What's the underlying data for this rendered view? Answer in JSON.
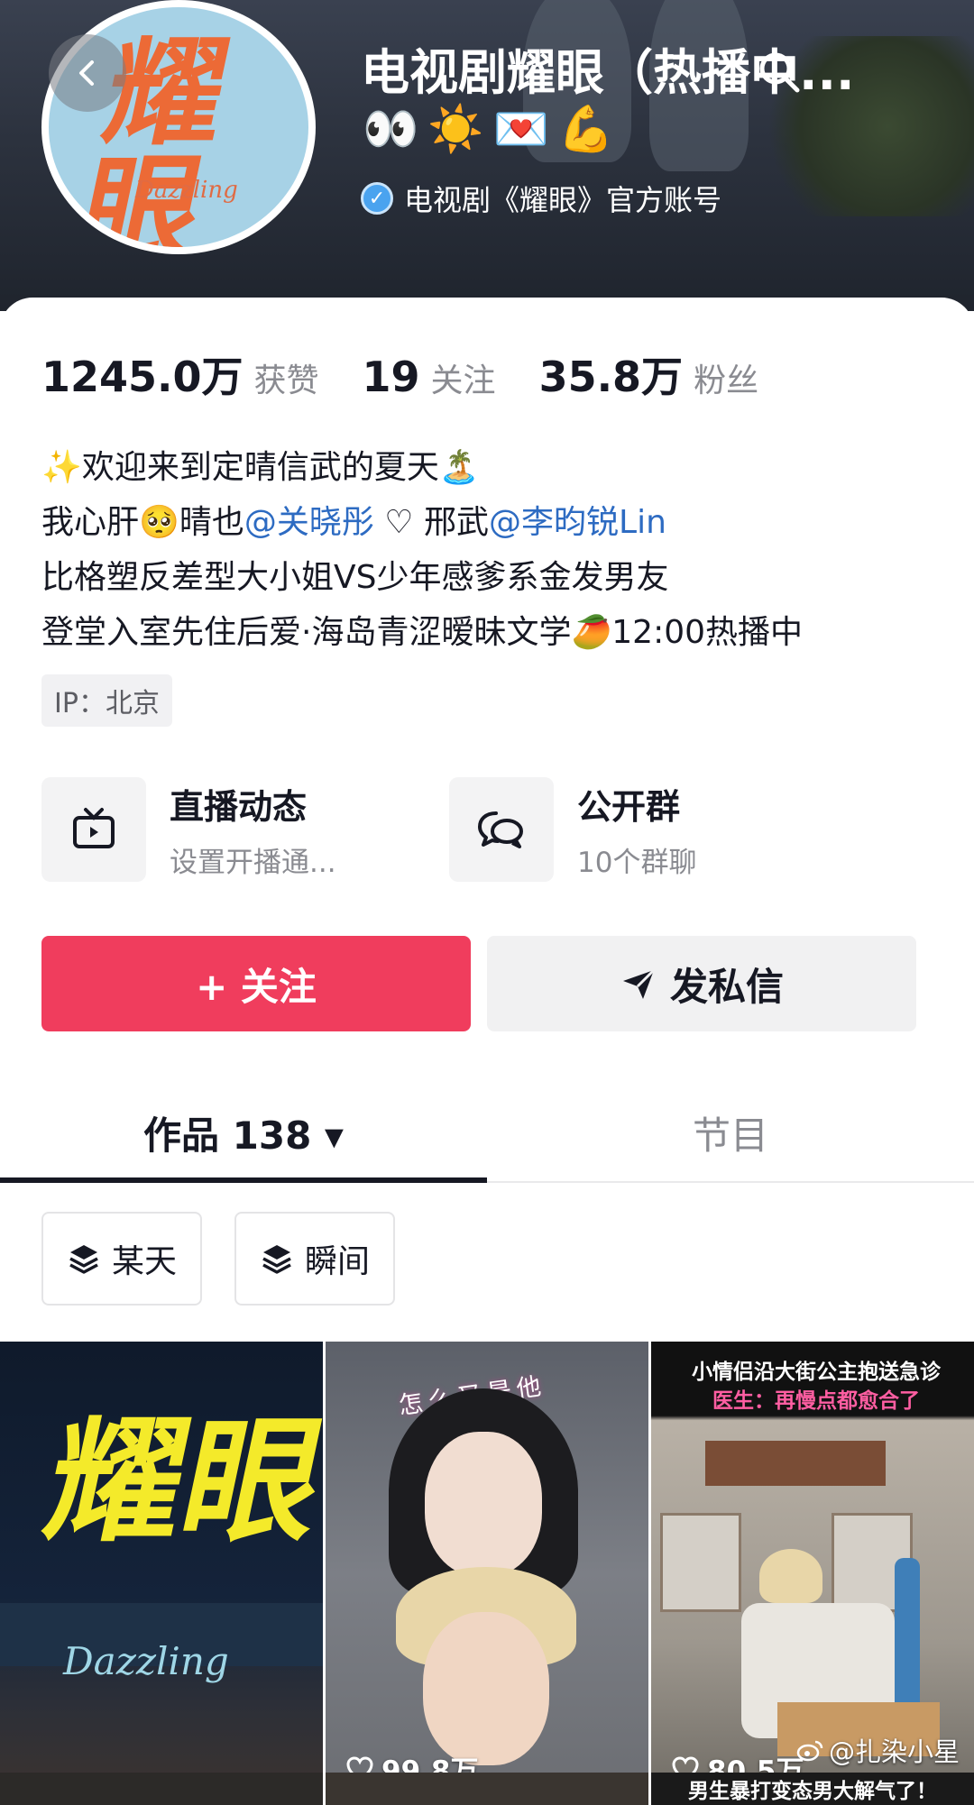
{
  "profile": {
    "name": "电视剧耀眼（热播中...",
    "emojis": [
      "👀",
      "☀️",
      "💌",
      "💪"
    ],
    "verified_text": "电视剧《耀眼》官方账号",
    "avatar_title": "耀眼",
    "avatar_script": "Dazzling"
  },
  "stats": [
    {
      "value": "1245.0万",
      "label": "获赞"
    },
    {
      "value": "19",
      "label": "关注"
    },
    {
      "value": "35.8万",
      "label": "粉丝"
    }
  ],
  "bio": {
    "line1": "✨欢迎来到定晴信武的夏天🏝️",
    "line2_prefix": "我心肝🥺晴也",
    "line2_mention1": "@关晓彤",
    "line2_middle": " ♡ 邢武",
    "line2_mention2": "@李昀锐Lin",
    "line3": "比格塑反差型大小姐VS少年感爹系金发男友",
    "line4": "登堂入室先住后爱·海岛青涩暧昧文学🥭12:00热播中"
  },
  "ip": "IP：北京",
  "features": {
    "live": {
      "title": "直播动态",
      "subtitle": "设置开播通..."
    },
    "group": {
      "title": "公开群",
      "subtitle": "10个群聊"
    }
  },
  "buttons": {
    "follow": "+ 关注",
    "message": "发私信"
  },
  "tabs": {
    "works": "作品 138 ▾",
    "shows": "节目"
  },
  "chips": {
    "someday": "某天",
    "moment": "瞬间"
  },
  "videos": [
    {
      "title": "耀眼",
      "script": "Dazzling",
      "likes": ""
    },
    {
      "caption": "怎么又是他",
      "likes": "99.8万"
    },
    {
      "line1": "小情侣沿大街公主抱送急诊",
      "line2": "医生：再慢点都愈合了",
      "likes": "80.5万"
    }
  ],
  "next_row_caption": "男生暴打变态男大解气了！",
  "watermark": "@扎染小星",
  "colors": {
    "accent": "#f03d5d",
    "mention": "#2d6bc2",
    "verified": "#4aa3ef"
  }
}
